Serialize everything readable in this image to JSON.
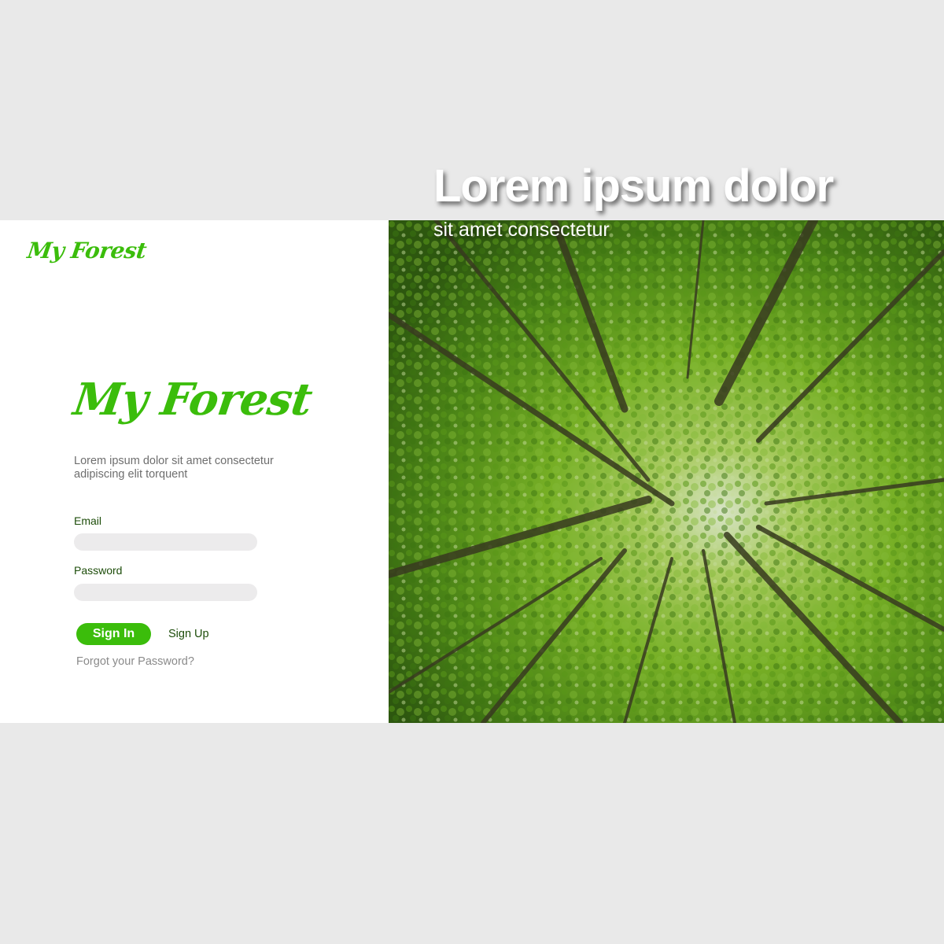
{
  "brand": {
    "logo_text": "My Forest",
    "color": "#3bbd0b"
  },
  "intro": {
    "tagline": "Lorem ipsum dolor sit amet consectetur adipiscing elit torquent"
  },
  "form": {
    "email_label": "Email",
    "email_value": "",
    "password_label": "Password",
    "password_value": "",
    "signin_label": "Sign In",
    "signup_label": "Sign Up",
    "forgot_label": "Forgot your Password?",
    "button_color": "#3bbd0b"
  },
  "hero": {
    "title": "Lorem ipsum dolor",
    "subtitle": "sit amet consectetur",
    "image": "forest-canopy"
  },
  "colors": {
    "page_bg": "#e9e9e9",
    "label_text": "#1d4d0a",
    "input_bg": "#ecebec"
  }
}
